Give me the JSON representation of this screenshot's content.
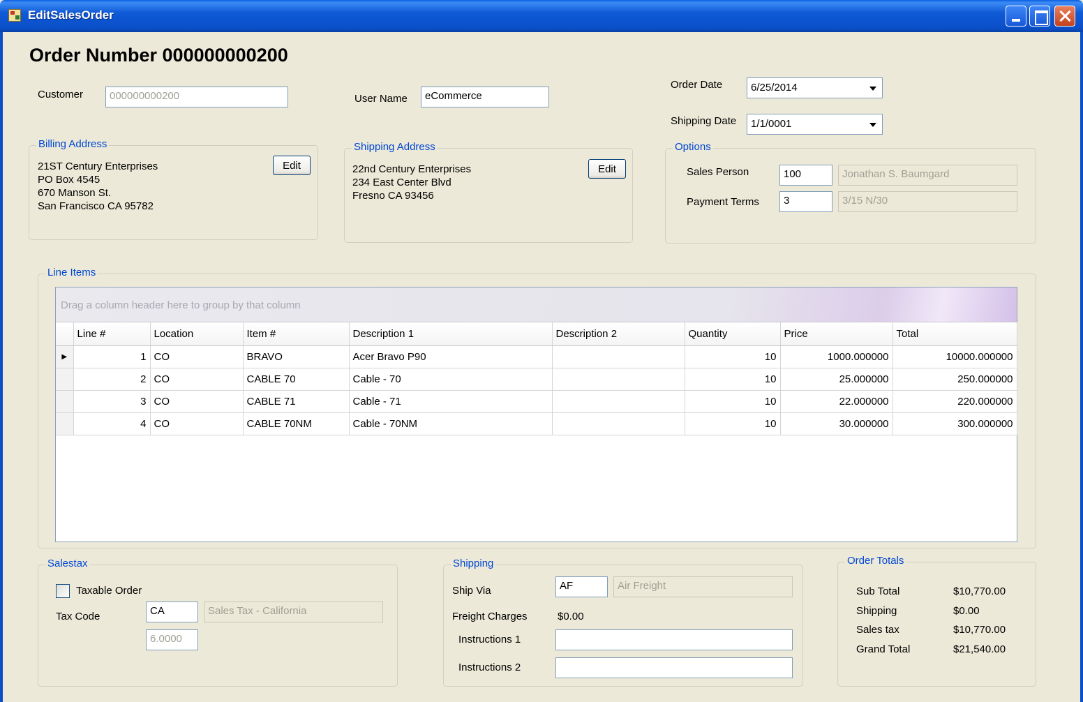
{
  "window": {
    "title": "EditSalesOrder"
  },
  "order": {
    "title": "Order Number 000000000200"
  },
  "customer": {
    "label": "Customer",
    "value": "000000000200"
  },
  "user": {
    "label": "User Name",
    "value": "eCommerce"
  },
  "dates": {
    "order_date_label": "Order Date",
    "order_date_value": "6/25/2014",
    "shipping_date_label": "Shipping Date",
    "shipping_date_value": "1/1/0001"
  },
  "billing": {
    "title": "Billing Address",
    "edit_label": "Edit",
    "lines": [
      "21ST Century Enterprises",
      "PO Box 4545",
      "670 Manson St.",
      "San Francisco CA 95782"
    ]
  },
  "shipping_address": {
    "title": "Shipping Address",
    "edit_label": "Edit",
    "lines": [
      "22nd Century Enterprises",
      "234 East Center Blvd",
      "Fresno CA 93456"
    ]
  },
  "options": {
    "title": "Options",
    "sales_person_label": "Sales Person",
    "sales_person_code": "100",
    "sales_person_name": "Jonathan S. Baumgard",
    "payment_terms_label": "Payment Terms",
    "payment_terms_code": "3",
    "payment_terms_name": "3/15 N/30"
  },
  "line_items": {
    "title": "Line Items",
    "group_hint": "Drag a column header here to group by that column",
    "columns": [
      "Line #",
      "Location",
      "Item #",
      "Description 1",
      "Description 2",
      "Quantity",
      "Price",
      "Total"
    ],
    "rows": [
      [
        "1",
        "CO",
        "BRAVO",
        "Acer Bravo P90",
        "",
        "10",
        "1000.000000",
        "10000.000000"
      ],
      [
        "2",
        "CO",
        "CABLE 70",
        "Cable - 70",
        "",
        "10",
        "25.000000",
        "250.000000"
      ],
      [
        "3",
        "CO",
        "CABLE 71",
        "Cable - 71",
        "",
        "10",
        "22.000000",
        "220.000000"
      ],
      [
        "4",
        "CO",
        "CABLE 70NM",
        "Cable - 70NM",
        "",
        "10",
        "30.000000",
        "300.000000"
      ]
    ]
  },
  "salestax": {
    "title": "Salestax",
    "taxable_label": "Taxable Order",
    "tax_code_label": "Tax Code",
    "tax_code": "CA",
    "tax_name": "Sales Tax - California",
    "tax_rate": "6.0000"
  },
  "shipping": {
    "title": "Shipping",
    "ship_via_label": "Ship Via",
    "ship_via_code": "AF",
    "ship_via_name": "Air Freight",
    "freight_label": "Freight Charges",
    "freight_value": "$0.00",
    "instructions1_label": "Instructions 1",
    "instructions1_value": "",
    "instructions2_label": "Instructions 2",
    "instructions2_value": ""
  },
  "totals": {
    "title": "Order Totals",
    "subtotal_label": "Sub Total",
    "subtotal_value": "$10,770.00",
    "shipping_label": "Shipping",
    "shipping_value": "$0.00",
    "salestax_label": "Sales tax",
    "salestax_value": "$10,770.00",
    "grand_label": "Grand Total",
    "grand_value": "$21,540.00"
  }
}
